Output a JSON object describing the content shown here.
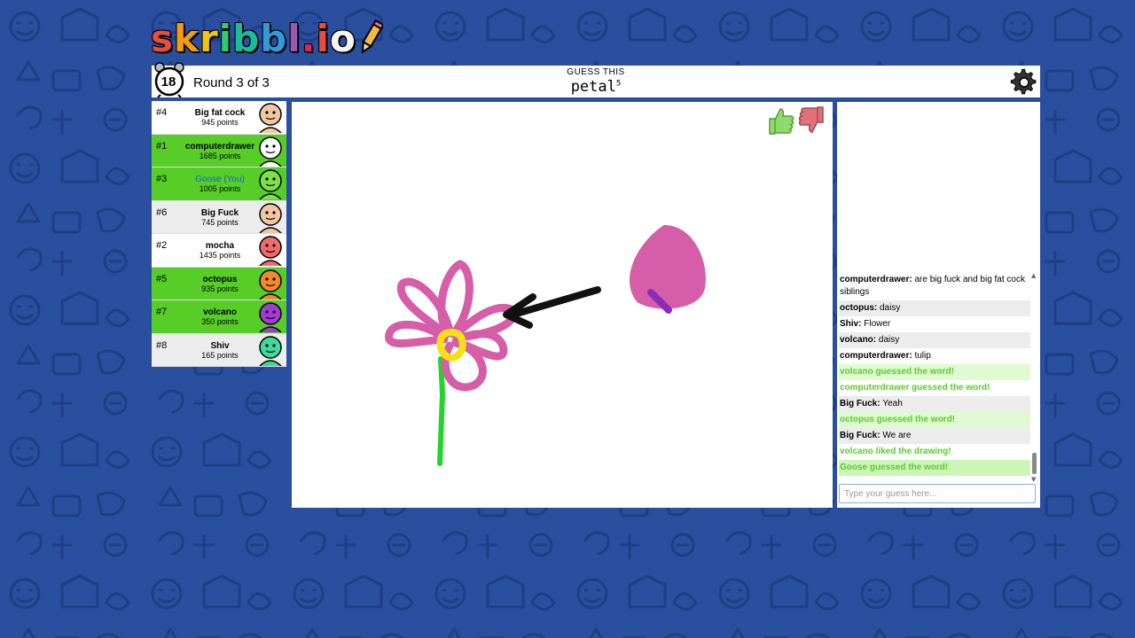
{
  "logo": {
    "letters": [
      {
        "ch": "s",
        "color": "#e74c3c"
      },
      {
        "ch": "k",
        "color": "#f39c12"
      },
      {
        "ch": "r",
        "color": "#f1c40f"
      },
      {
        "ch": "i",
        "color": "#2ecc71"
      },
      {
        "ch": "b",
        "color": "#1abc9c"
      },
      {
        "ch": "b",
        "color": "#3498db"
      },
      {
        "ch": "l",
        "color": "#9b59b6"
      },
      {
        "ch": ".",
        "color": "#e91e63"
      },
      {
        "ch": "i",
        "color": "#e74c3c"
      },
      {
        "ch": "o",
        "color": "#f5f5f5"
      }
    ]
  },
  "header": {
    "timer": "18",
    "round": "Round 3 of 3",
    "guess_label": "GUESS THIS",
    "word": "petal",
    "word_length": "5"
  },
  "players": [
    {
      "rank": "#4",
      "name": "Big fat cock",
      "points": "945 points",
      "bg": "#ffffff",
      "avatar": "#f2c6a0"
    },
    {
      "rank": "#1",
      "name": "computerdrawer",
      "points": "1685 points",
      "bg": "#56ce27",
      "avatar": "#ffffff"
    },
    {
      "rank": "#3",
      "name": "Goose (You)",
      "points": "1005 points",
      "bg": "#56ce27",
      "avatar": "#7ee04a"
    },
    {
      "rank": "#6",
      "name": "Big Fuck",
      "points": "745 points",
      "bg": "#ececec",
      "avatar": "#f2c6a0"
    },
    {
      "rank": "#2",
      "name": "mocha",
      "points": "1435 points",
      "bg": "#ffffff",
      "avatar": "#ef6b6b"
    },
    {
      "rank": "#5",
      "name": "octopus",
      "points": "935 points",
      "bg": "#56ce27",
      "avatar": "#f08a2b"
    },
    {
      "rank": "#7",
      "name": "volcano",
      "points": "350 points",
      "bg": "#56ce27",
      "avatar": "#a33ad6"
    },
    {
      "rank": "#8",
      "name": "Shiv",
      "points": "165 points",
      "bg": "#ececec",
      "avatar": "#3fd99b"
    }
  ],
  "chat": [
    {
      "user": "computerdrawer",
      "text": "are big fuck and big fat cock siblings",
      "style": "normal"
    },
    {
      "user": "octopus",
      "text": "daisy",
      "style": "alt"
    },
    {
      "user": "Shiv",
      "text": "Flower",
      "style": "normal"
    },
    {
      "user": "volcano",
      "text": "daisy",
      "style": "alt"
    },
    {
      "user": "computerdrawer",
      "text": "tulip",
      "style": "normal"
    },
    {
      "user": "",
      "text": "volcano guessed the word!",
      "style": "green-alt"
    },
    {
      "user": "",
      "text": "computerdrawer guessed the word!",
      "style": "green"
    },
    {
      "user": "Big Fuck",
      "text": "Yeah",
      "style": "alt"
    },
    {
      "user": "",
      "text": "octopus guessed the word!",
      "style": "green-alt"
    },
    {
      "user": "Big Fuck",
      "text": "We are",
      "style": "alt"
    },
    {
      "user": "",
      "text": "volcano liked the drawing!",
      "style": "green"
    },
    {
      "user": "",
      "text": "Goose guessed the word!",
      "style": "greenbg"
    }
  ],
  "chat_input": {
    "placeholder": "Type your guess here..."
  },
  "colors": {
    "background": "#2a4f9e",
    "green": "#56ce27",
    "petal": "#d65ea8",
    "stem": "#22d42b",
    "center": "#f5e016"
  }
}
